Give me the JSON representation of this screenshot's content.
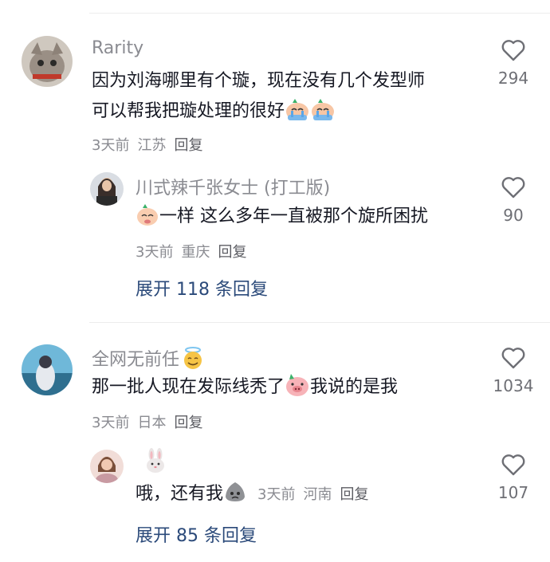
{
  "comments": [
    {
      "author": "Rarity",
      "text_line1": "因为刘海哪里有个璇，现在没有几个发型师",
      "text_line2": "可以帮我把璇处理的很好",
      "time": "3天前",
      "location": "江苏",
      "reply_label": "回复",
      "likes": "294",
      "reply": {
        "author_name": "川式辣千张女士",
        "author_tag": "(打工版)",
        "text": "一样 这么多年一直被那个旋所困扰",
        "time": "3天前",
        "location": "重庆",
        "reply_label": "回复",
        "likes": "90"
      },
      "expand_label": "展开 118 条回复"
    },
    {
      "author": "全网无前任",
      "text_before_emoji": "那一批人现在发际线秃了",
      "text_after_emoji": "我说的是我",
      "time": "3天前",
      "location": "日本",
      "reply_label": "回复",
      "likes": "1034",
      "reply": {
        "author_name": "",
        "text": "哦，还有我",
        "time": "3天前",
        "location": "河南",
        "reply_label": "回复",
        "likes": "107"
      },
      "expand_label": "展开 85 条回复"
    }
  ],
  "icons": {
    "like": "heart-outline-icon",
    "crying": "crying-face-emoji",
    "pig": "pig-face-emoji",
    "halo": "smiling-face-with-halo-emoji",
    "rabbit": "rabbit-face-emoji",
    "ghost": "grey-blob-emoji"
  },
  "colors": {
    "author": "#8a8b91",
    "text": "#161823",
    "meta": "#8a8b91",
    "expand": "#2b4a7a",
    "divider": "#ececec"
  }
}
